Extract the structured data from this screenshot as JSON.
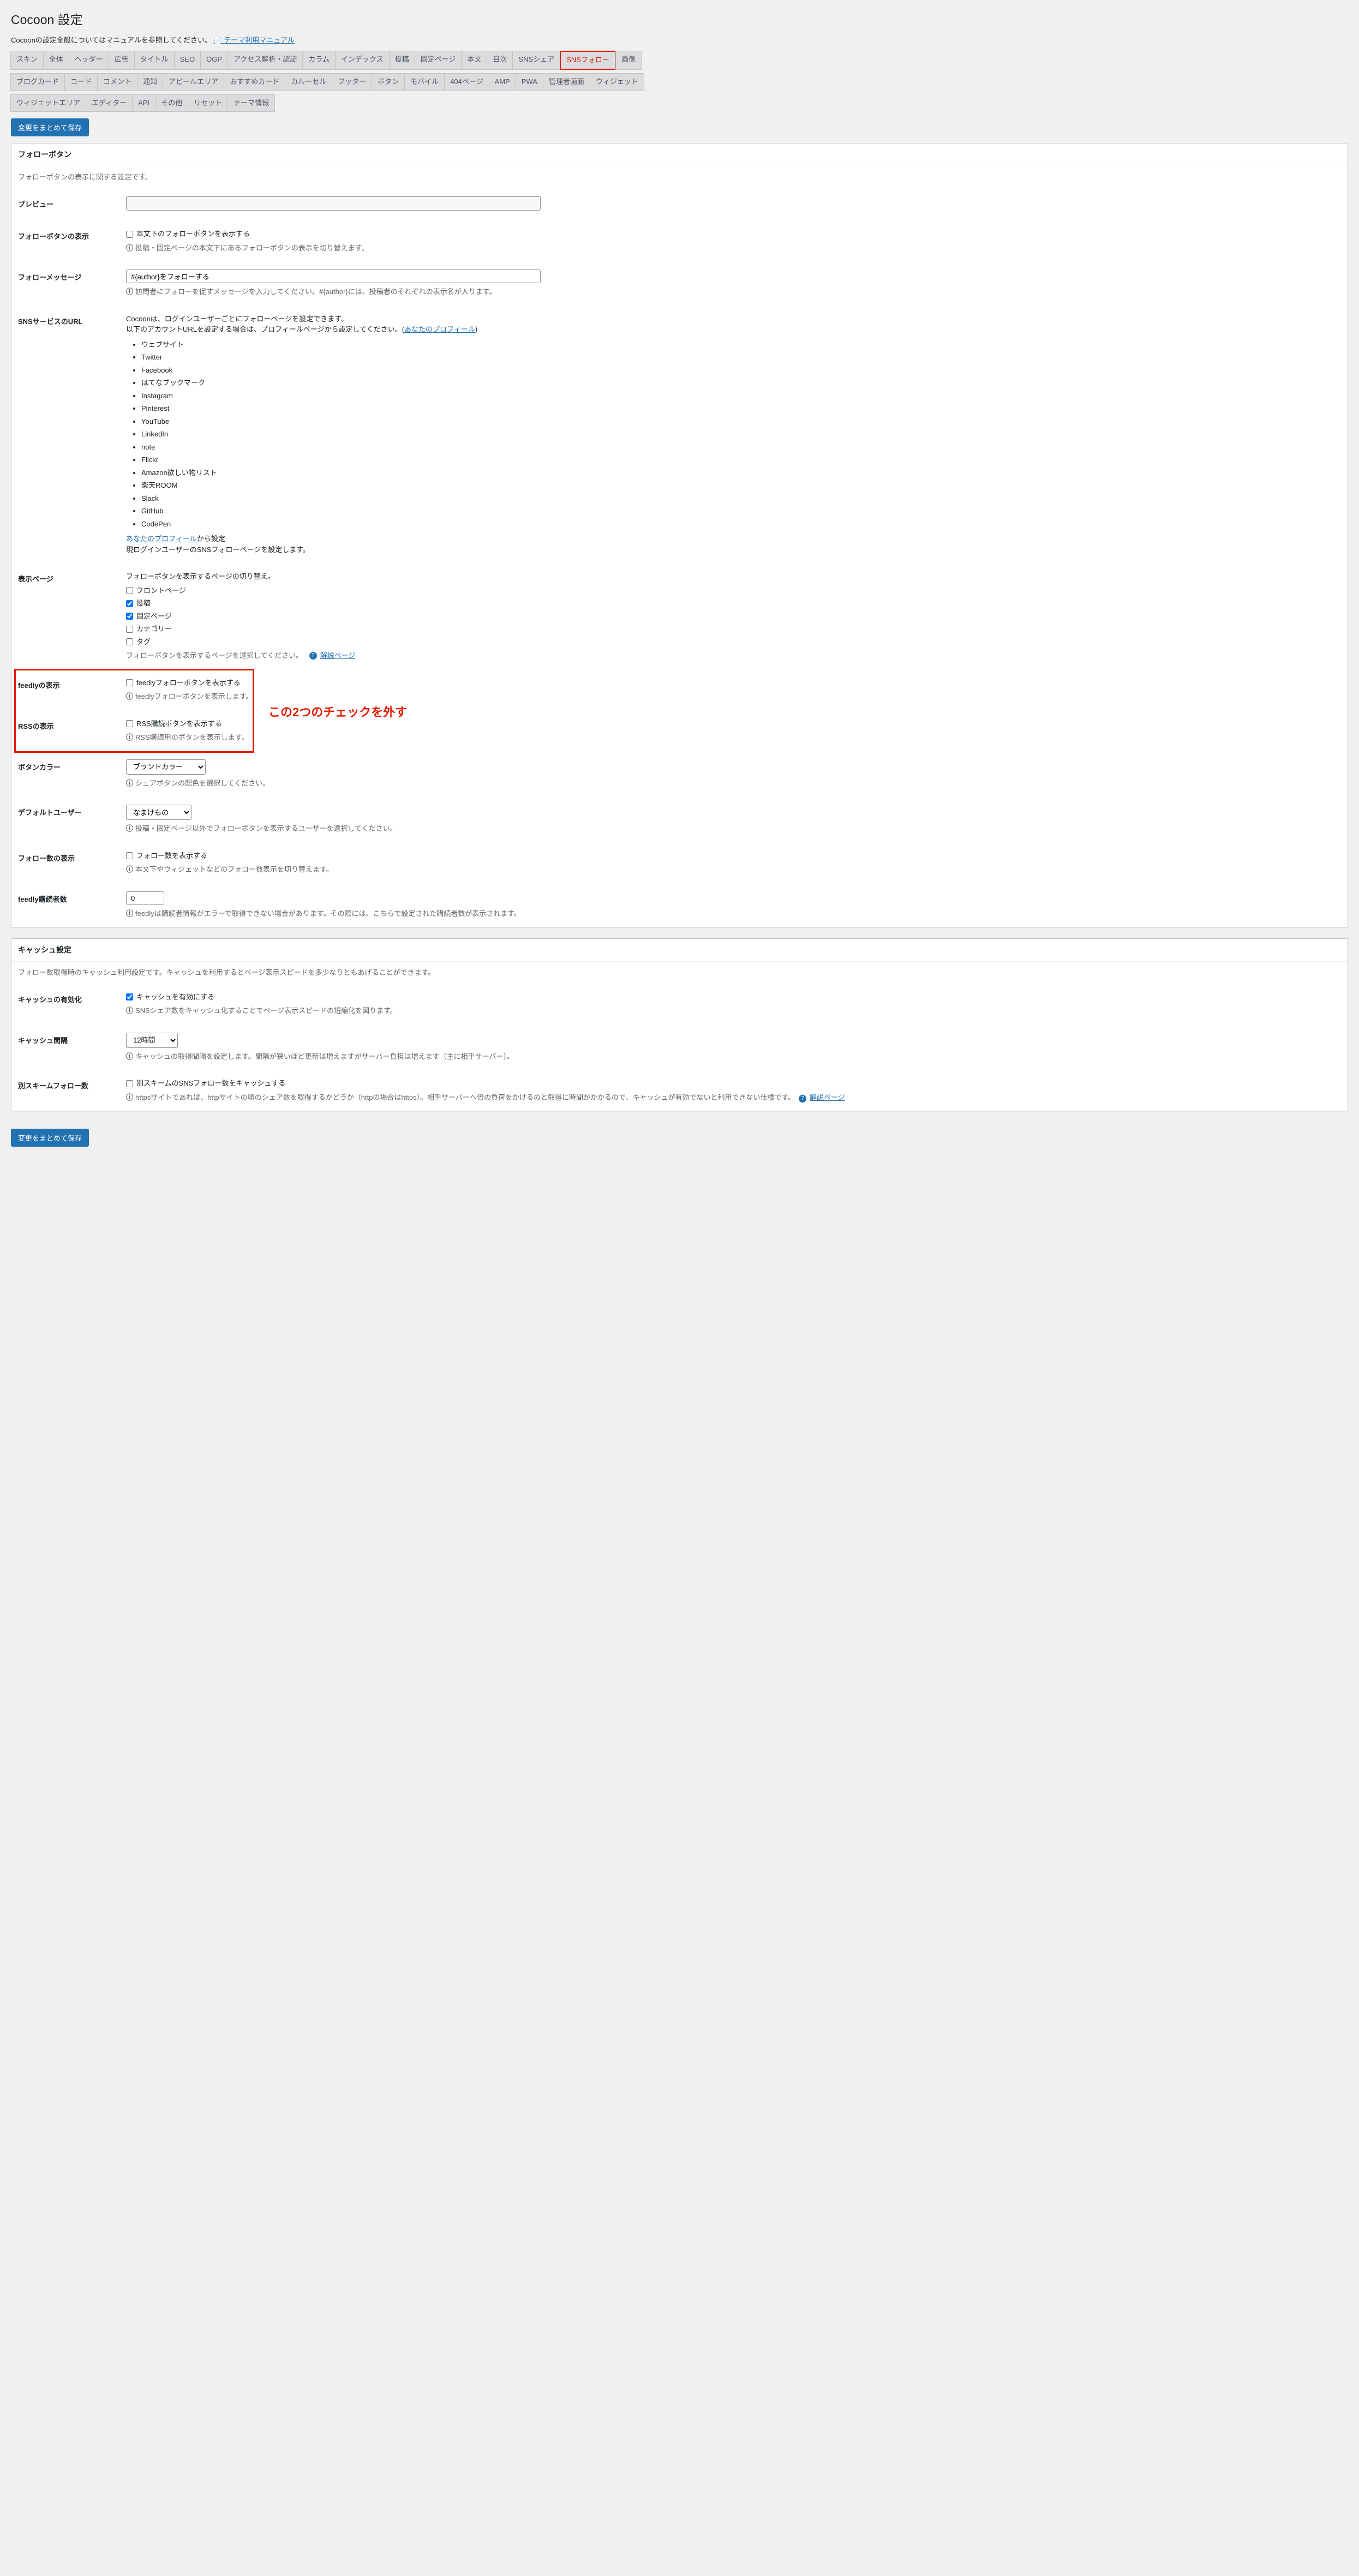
{
  "page_title": "Cocoon 設定",
  "intro_text": "Cocoonの設定全般についてはマニュアルを参照してください。",
  "intro_link": "テーマ利用マニュアル",
  "tabs_row1": [
    "スキン",
    "全体",
    "ヘッダー",
    "広告",
    "タイトル",
    "SEO",
    "OGP",
    "アクセス解析・認証",
    "カラム",
    "インデックス",
    "投稿",
    "固定ページ",
    "本文",
    "目次",
    "SNSシェア",
    "SNSフォロー",
    "画像"
  ],
  "tabs_row2": [
    "ブログカード",
    "コード",
    "コメント",
    "通知",
    "アピールエリア",
    "おすすめカード",
    "カルーセル",
    "フッター",
    "ボタン",
    "モバイル",
    "404ページ",
    "AMP",
    "PWA",
    "管理者画面",
    "ウィジェット"
  ],
  "tabs_row3": [
    "ウィジェットエリア",
    "エディター",
    "API",
    "その他",
    "リセット",
    "テーマ情報"
  ],
  "save_button": "変更をまとめて保存",
  "follow_section": {
    "title": "フォローボタン",
    "desc": "フォローボタンの表示に関する設定です。",
    "preview_label": "プレビュー",
    "display": {
      "label": "フォローボタンの表示",
      "checkbox": "本文下のフォローボタンを表示する",
      "info": "投稿・固定ページの本文下にあるフォローボタンの表示を切り替えます。"
    },
    "message": {
      "label": "フォローメッセージ",
      "value": "#{author}をフォローする",
      "info": "訪問者にフォローを促すメッセージを入力してください。#{author}には、投稿者のそれぞれの表示名が入ります。"
    },
    "sns_url": {
      "label": "SNSサービスのURL",
      "line1": "Cocoonは、ログインユーザーごとにフォローページを設定できます。",
      "line2_pre": "以下のアカウントURLを設定する場合は、プロフィールページから設定してください。(",
      "line2_link": "あなたのプロフィール",
      "line2_post": ")",
      "services": [
        "ウェブサイト",
        "Twitter",
        "Facebook",
        "はてなブックマーク",
        "Instagram",
        "Pinterest",
        "YouTube",
        "LinkedIn",
        "note",
        "Flickr",
        "Amazon欲しい物リスト",
        "楽天ROOM",
        "Slack",
        "GitHub",
        "CodePen"
      ],
      "link_text": "あなたのプロフィール",
      "after_link": "から設定",
      "line3": "現ログインユーザーのSNSフォローページを設定します。"
    },
    "pages": {
      "label": "表示ページ",
      "desc": "フォローボタンを表示するページの切り替え。",
      "items": [
        {
          "label": "フロントページ",
          "checked": false
        },
        {
          "label": "投稿",
          "checked": true
        },
        {
          "label": "固定ページ",
          "checked": true
        },
        {
          "label": "カテゴリー",
          "checked": false
        },
        {
          "label": "タグ",
          "checked": false
        }
      ],
      "info": "フォローボタンを表示するページを選択してください。",
      "help": "解説ページ"
    },
    "feedly": {
      "label": "feedlyの表示",
      "checkbox": "feedlyフォローボタンを表示する",
      "info": "feedlyフォローボタンを表示します。"
    },
    "rss": {
      "label": "RSSの表示",
      "checkbox": "RSS購読ボタンを表示する",
      "info": "RSS購読用のボタンを表示します。"
    },
    "color": {
      "label": "ボタンカラー",
      "selected": "ブランドカラー",
      "info": "シェアボタンの配色を選択してください。"
    },
    "user": {
      "label": "デフォルトユーザー",
      "selected": "なまけもの",
      "info": "投稿・固定ページ以外でフォローボタンを表示するユーザーを選択してください。"
    },
    "count": {
      "label": "フォロー数の表示",
      "checkbox": "フォロー数を表示する",
      "info": "本文下やウィジェットなどのフォロー数表示を切り替えます。"
    },
    "feedly_count": {
      "label": "feedly購読者数",
      "value": "0",
      "info": "feedlyは購読者情報がエラーで取得できない場合があります。その際には、こちらで設定された購読者数が表示されます。"
    }
  },
  "cache_section": {
    "title": "キャッシュ設定",
    "desc": "フォロー数取得時のキャッシュ利用設定です。キャッシュを利用するとページ表示スピードを多少なりともあげることができます。",
    "enable": {
      "label": "キャッシュの有効化",
      "checkbox": "キャッシュを有効にする",
      "checked": true,
      "info": "SNSシェア数をキャッシュ化することでページ表示スピードの短縮化を図ります。"
    },
    "interval": {
      "label": "キャッシュ間隔",
      "selected": "12時間",
      "info": "キャッシュの取得間隔を設定します。間隔が狭いほど更新は増えますがサーバー負担は増えます（主に相手サーバー）。"
    },
    "scheme": {
      "label": "別スキームフォロー数",
      "checkbox": "別スキームのSNSフォロー数をキャッシュする",
      "info": "httpsサイトであれば、httpサイトの頃のシェア数を取得するかどうか（httpの場合はhttps）。相手サーバーへ倍の負荷をかけるのと取得に時間がかかるので、キャッシュが有効でないと利用できない仕様です。",
      "help": "解説ページ"
    }
  },
  "annotation": "この2つのチェックを外す"
}
